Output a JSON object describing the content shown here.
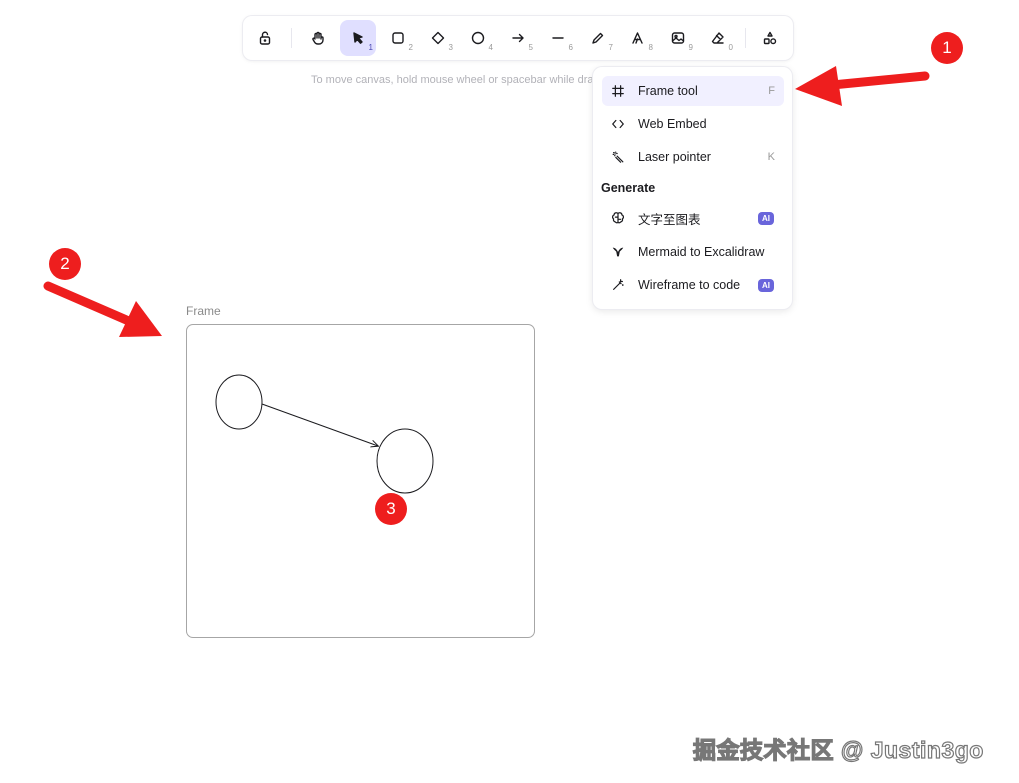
{
  "toolbar": {
    "tools": [
      {
        "name": "lock",
        "key": ""
      },
      {
        "name": "hand",
        "key": ""
      },
      {
        "name": "selection",
        "key": "1"
      },
      {
        "name": "rectangle",
        "key": "2"
      },
      {
        "name": "diamond",
        "key": "3"
      },
      {
        "name": "ellipse",
        "key": "4"
      },
      {
        "name": "arrow",
        "key": "5"
      },
      {
        "name": "line",
        "key": "6"
      },
      {
        "name": "draw",
        "key": "7"
      },
      {
        "name": "text",
        "key": "8"
      },
      {
        "name": "image",
        "key": "9"
      },
      {
        "name": "eraser",
        "key": "0"
      },
      {
        "name": "extra-tools",
        "key": ""
      }
    ]
  },
  "hint": "To move canvas, hold mouse wheel or spacebar while dra",
  "menu": {
    "items": [
      {
        "label": "Frame tool",
        "shortcut": "F",
        "icon": "frame-icon"
      },
      {
        "label": "Web Embed",
        "shortcut": "",
        "icon": "code-icon"
      },
      {
        "label": "Laser pointer",
        "shortcut": "K",
        "icon": "laser-icon"
      }
    ],
    "group_title": "Generate",
    "generate": [
      {
        "label": "文字至图表",
        "badge": "AI",
        "icon": "brain-icon"
      },
      {
        "label": "Mermaid to Excalidraw",
        "badge": "",
        "icon": "mermaid-icon"
      },
      {
        "label": "Wireframe to code",
        "badge": "AI",
        "icon": "magic-wand-icon"
      }
    ]
  },
  "canvas": {
    "frame_label": "Frame"
  },
  "annotations": {
    "badge1": "1",
    "badge2": "2",
    "badge3": "3",
    "accent": "#ee1e1e"
  },
  "watermark": "掘金技术社区 @ Justin3go"
}
